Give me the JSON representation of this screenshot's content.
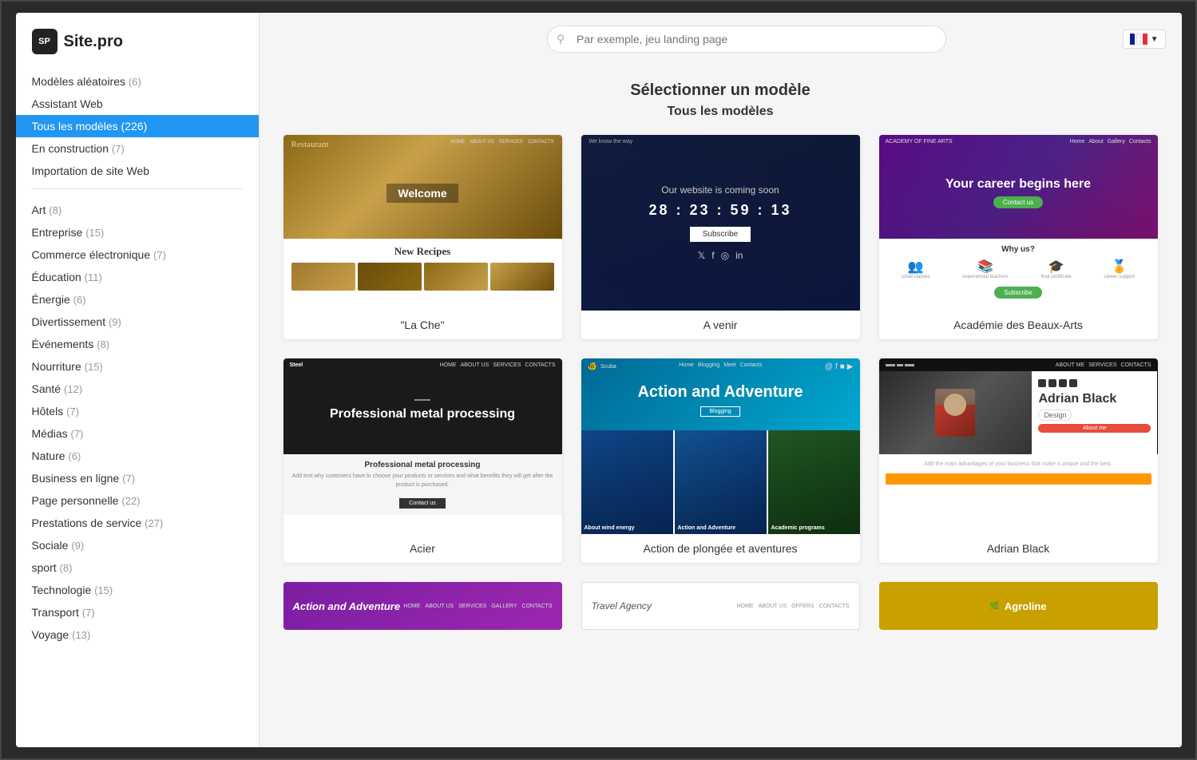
{
  "app": {
    "logo_initials": "SP",
    "logo_name": "Site.pro"
  },
  "sidebar": {
    "top_items": [
      {
        "id": "random",
        "label": "Modèles aléatoires",
        "count": "(6)"
      },
      {
        "id": "assistant",
        "label": "Assistant Web",
        "count": ""
      },
      {
        "id": "all",
        "label": "Tous les modèles (226)",
        "count": "",
        "active": true
      },
      {
        "id": "construction",
        "label": "En construction",
        "count": "(7)"
      },
      {
        "id": "import",
        "label": "Importation de site Web",
        "count": ""
      }
    ],
    "categories": [
      {
        "id": "art",
        "label": "Art",
        "count": "(8)"
      },
      {
        "id": "entreprise",
        "label": "Entreprise",
        "count": "(15)"
      },
      {
        "id": "commerce",
        "label": "Commerce électronique",
        "count": "(7)"
      },
      {
        "id": "education",
        "label": "Éducation",
        "count": "(11)"
      },
      {
        "id": "energie",
        "label": "Énergie",
        "count": "(6)"
      },
      {
        "id": "divertissement",
        "label": "Divertissement",
        "count": "(9)"
      },
      {
        "id": "evenements",
        "label": "Événements",
        "count": "(8)"
      },
      {
        "id": "nourriture",
        "label": "Nourriture",
        "count": "(15)"
      },
      {
        "id": "sante",
        "label": "Santé",
        "count": "(12)"
      },
      {
        "id": "hotels",
        "label": "Hôtels",
        "count": "(7)"
      },
      {
        "id": "medias",
        "label": "Médias",
        "count": "(7)"
      },
      {
        "id": "nature",
        "label": "Nature",
        "count": "(6)"
      },
      {
        "id": "business",
        "label": "Business en ligne",
        "count": "(7)"
      },
      {
        "id": "page-perso",
        "label": "Page personnelle",
        "count": "(22)"
      },
      {
        "id": "prestations",
        "label": "Prestations de service",
        "count": "(27)"
      },
      {
        "id": "sociale",
        "label": "Sociale",
        "count": "(9)"
      },
      {
        "id": "sport",
        "label": "sport",
        "count": "(8)"
      },
      {
        "id": "technologie",
        "label": "Technologie",
        "count": "(15)"
      },
      {
        "id": "transport",
        "label": "Transport",
        "count": "(7)"
      },
      {
        "id": "voyage",
        "label": "Voyage",
        "count": "(13)"
      }
    ]
  },
  "header": {
    "search_placeholder": "Par exemple, jeu landing page",
    "page_title": "Sélectionner un modèle",
    "section_title": "Tous les modèles"
  },
  "templates": [
    {
      "id": "la-che",
      "label": "\"La Che\"",
      "type": "restaurant"
    },
    {
      "id": "a-venir",
      "label": "A venir",
      "type": "avenir",
      "subtitle": "Our website is coming soon",
      "timer": "28 : 23 : 59 : 13",
      "subscribe_label": "Subscribe"
    },
    {
      "id": "academie",
      "label": "Académie des Beaux-Arts",
      "type": "academy",
      "title": "Your career begins here",
      "why_us": "Why us?",
      "contact_label": "Contact us"
    },
    {
      "id": "acier",
      "label": "Acier",
      "type": "steel",
      "title": "Professional metal processing",
      "desc": "Add text why customers have to choose your products or services and what benefits they will get after the product is purchased."
    },
    {
      "id": "action-plongee",
      "label": "Action de plongée et aventures",
      "type": "scuba",
      "title": "Action and Adventure",
      "grid_items": [
        {
          "label": "About wind energy"
        },
        {
          "label": "Action and Adventure"
        },
        {
          "label": "Academic programs"
        }
      ]
    },
    {
      "id": "adrian-black",
      "label": "Adrian Black",
      "type": "adrian",
      "name": "Adrian Black",
      "role": "Design",
      "about_label": "About me",
      "desc": "Add the main advantages of your business that make it unique and the best."
    }
  ],
  "bottom_templates": [
    {
      "id": "action-adventure",
      "label": "Action and Adventure",
      "type": "purple"
    },
    {
      "id": "travel-agency",
      "label": "Travel Agency",
      "type": "white"
    },
    {
      "id": "agroline",
      "label": "Agroline",
      "type": "gold"
    }
  ]
}
